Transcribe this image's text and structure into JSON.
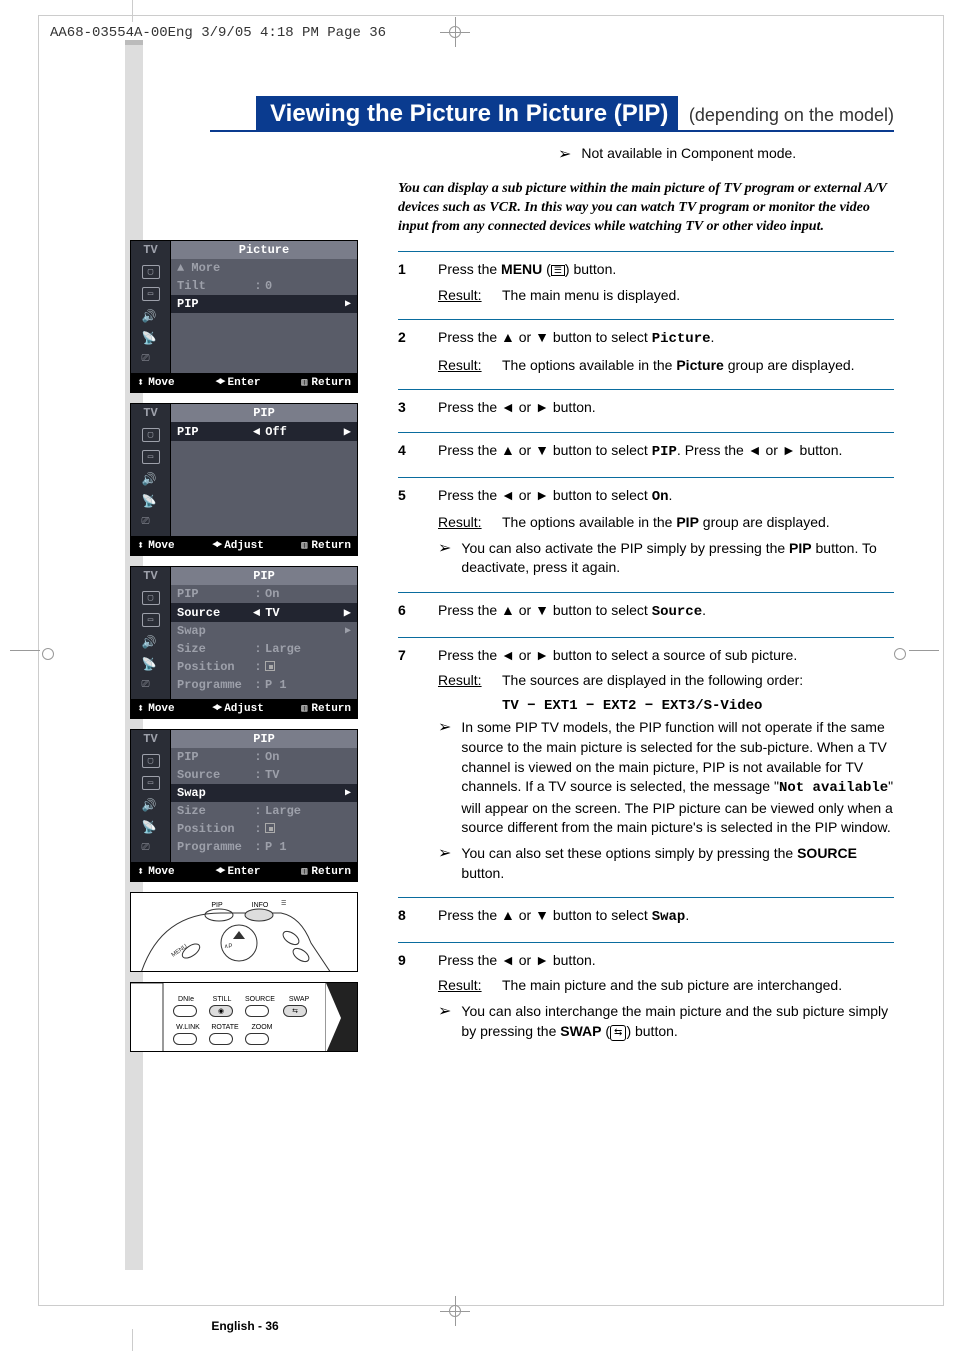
{
  "header_meta": "AA68-03554A-00Eng  3/9/05  4:18 PM  Page 36",
  "title_main": "Viewing the Picture In Picture (PIP)",
  "title_suffix": "(depending on the model)",
  "top_note": "Not available in Component mode.",
  "intro": "You can display a sub picture within the main picture of TV program or external A/V devices such as VCR. In this way you can watch TV program or monitor the video input from any connected devices while watching TV or other video input.",
  "osd": {
    "tv": "TV",
    "footer_move": "Move",
    "footer_enter": "Enter",
    "footer_adjust": "Adjust",
    "footer_return": "Return"
  },
  "menu1": {
    "title": "Picture",
    "rows": {
      "more": "▲ More",
      "tilt_label": "Tilt",
      "tilt_value": "0",
      "pip": "PIP"
    }
  },
  "menu2": {
    "title": "PIP",
    "pip_label": "PIP",
    "pip_value": "Off"
  },
  "menu3": {
    "title": "PIP",
    "pip": {
      "label": "PIP",
      "value": "On"
    },
    "source": {
      "label": "Source",
      "value": "TV"
    },
    "swap": "Swap",
    "size": {
      "label": "Size",
      "value": "Large"
    },
    "position": {
      "label": "Position"
    },
    "programme": {
      "label": "Programme",
      "value": "P 1"
    }
  },
  "menu4": {
    "title": "PIP",
    "pip": {
      "label": "PIP",
      "value": "On"
    },
    "source": {
      "label": "Source",
      "value": "TV"
    },
    "swap": "Swap",
    "size": {
      "label": "Size",
      "value": "Large"
    },
    "position": {
      "label": "Position"
    },
    "programme": {
      "label": "Programme",
      "value": "P 1"
    }
  },
  "remote1_labels": {
    "pip": "PIP",
    "info": "INFO",
    "ssm": "S.STD"
  },
  "remote2_labels": {
    "dnie": "DNIe",
    "still": "STILL",
    "source": "SOURCE",
    "swap": "SWAP",
    "wlink": "W.LINK",
    "rotate": "ROTATE",
    "zoom": "ZOOM"
  },
  "steps": [
    {
      "num": "1",
      "lines": [
        {
          "type": "p",
          "html": "Press the <b>MENU</b> (<span class='menu-icon-inline' data-name='menu-button-icon' data-interactable='false'>☰</span>) button."
        },
        {
          "type": "result",
          "text": "The main menu is displayed."
        }
      ]
    },
    {
      "num": "2",
      "lines": [
        {
          "type": "p",
          "html": "Press the ▲ or ▼ button to select <span class='mono'>Picture</span>."
        },
        {
          "type": "result",
          "text": "The options available in the <b>Picture</b> group are displayed."
        }
      ]
    },
    {
      "num": "3",
      "lines": [
        {
          "type": "p",
          "html": "Press the ◄ or ► button."
        }
      ]
    },
    {
      "num": "4",
      "lines": [
        {
          "type": "p",
          "html": "Press the ▲ or ▼  button to select <span class='mono'>PIP</span>. Press the ◄ or ► button."
        }
      ]
    },
    {
      "num": "5",
      "lines": [
        {
          "type": "p",
          "html": "Press the ◄ or ► button to select <span class='mono'>On</span>."
        },
        {
          "type": "result",
          "text": "The options available in the <b>PIP</b> group are displayed."
        },
        {
          "type": "note",
          "html": "You can also activate the PIP simply by pressing the <b>PIP</b> button. To deactivate, press it again."
        }
      ]
    },
    {
      "num": "6",
      "lines": [
        {
          "type": "p",
          "html": "Press the ▲ or ▼ button to select <span class='mono'>Source</span>."
        }
      ]
    },
    {
      "num": "7",
      "lines": [
        {
          "type": "p",
          "html": "Press the ◄ or ► button to select a source of sub picture."
        },
        {
          "type": "result",
          "text": "The sources are displayed in the following order:"
        },
        {
          "type": "order",
          "text": "TV − EXT1 − EXT2 − EXT3/S-Video"
        },
        {
          "type": "note",
          "html": "In some PIP TV models, the PIP function will not operate if the same source to the main picture is selected for the sub-picture. When a TV channel is viewed on the main picture, PIP is not available for TV channels. If a TV source is selected, the message \"<span class='mono'>Not available</span>\" will appear on the screen. The PIP picture can be viewed only when a source different from the main picture's is selected in the PIP window."
        },
        {
          "type": "note",
          "html": "You can also set these options simply by pressing the <b>SOURCE</b> button."
        }
      ]
    },
    {
      "num": "8",
      "lines": [
        {
          "type": "p",
          "html": "Press the ▲ or ▼ button to select <span class='mono'>Swap</span>."
        }
      ]
    },
    {
      "num": "9",
      "lines": [
        {
          "type": "p",
          "html": "Press the ◄ or ► button."
        },
        {
          "type": "result",
          "text": "The main picture and the sub picture are interchanged."
        },
        {
          "type": "note",
          "html": "You can also interchange the main picture and the sub picture simply by pressing the <b>SWAP</b> (<span class='swap-icon-inline' data-name='swap-button-icon' data-interactable='false'>⇆</span>) button."
        }
      ]
    }
  ],
  "result_label": "Result:",
  "footer_page": "English - 36"
}
